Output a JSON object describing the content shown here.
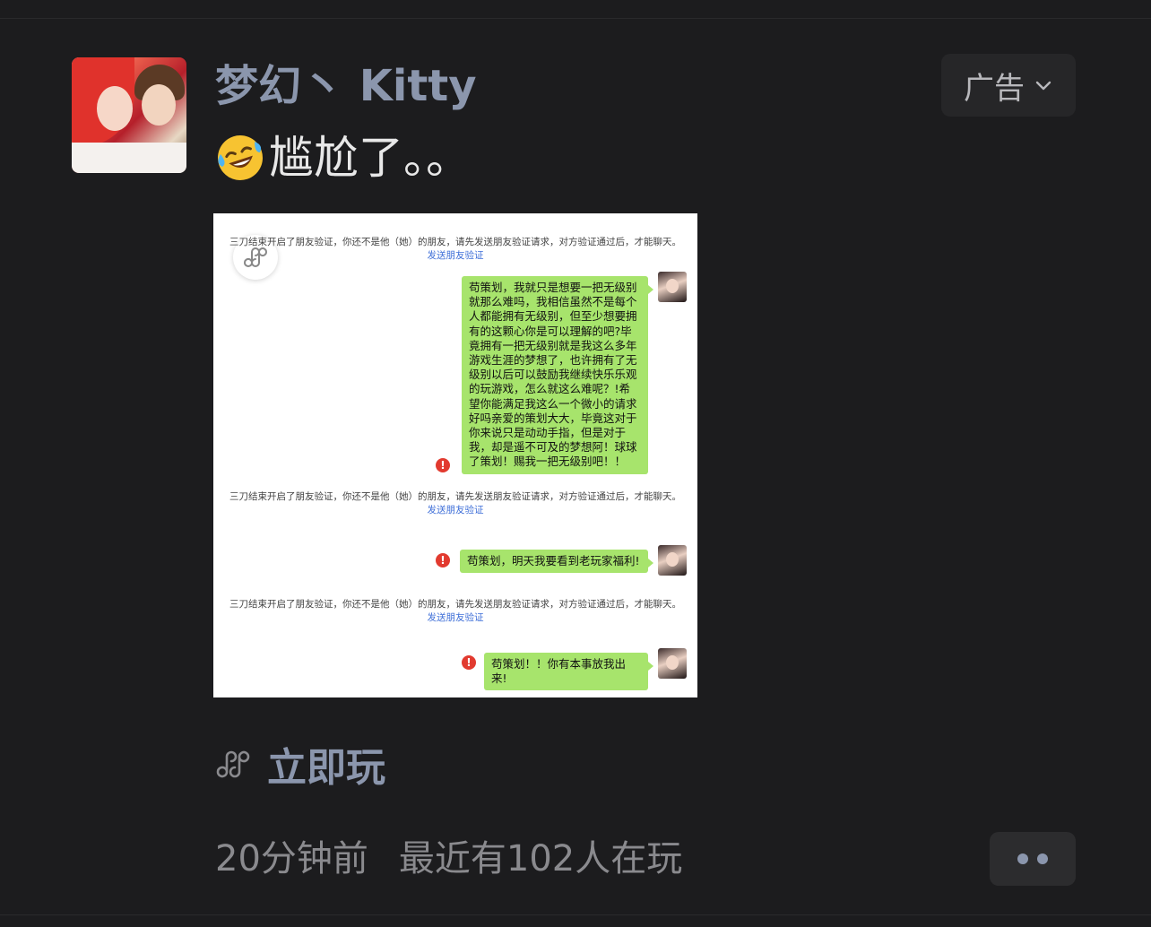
{
  "post": {
    "username": "梦幻丶 Kitty",
    "text": "尴尬了。。",
    "ad_label": "广告",
    "play_label": "立即玩",
    "time": "20分钟前",
    "players": "最近有102人在玩"
  },
  "screenshot": {
    "system_message": "三刀结束开启了朋友验证，你还不是他（她）的朋友，请先发送朋友验证请求，对方验证通过后，才能聊天。",
    "send_verify_link": "发送朋友验证",
    "messages": [
      "苟策划，我就只是想要一把无级别就那么难吗，我相信虽然不是每个人都能拥有无级别，但至少想要拥有的这颗心你是可以理解的吧?毕竟拥有一把无级别就是我这么多年游戏生涯的梦想了，也许拥有了无级别以后可以鼓励我继续快乐乐观的玩游戏，怎么就这么难呢？!希望你能满足我这么一个微小的请求好吗亲爱的策划大大，毕竟这对于你来说只是动动手指，但是对于我，却是遥不可及的梦想阿！球球了策划！赐我一把无级别吧！！",
      "苟策划，明天我要看到老玩家福利!",
      "苟策划！！你有本事放我出来!"
    ]
  },
  "icons": {
    "emoji": "crying-laughing-emoji",
    "ad_dropdown": "chevron-down-icon",
    "mini_program": "mini-program-link-icon",
    "error": "error-icon",
    "more": "more-dots-icon"
  },
  "colors": {
    "background": "#1c1c1e",
    "username": "#8b96ad",
    "bubble": "#a7e46c",
    "error": "#e23a2f"
  }
}
